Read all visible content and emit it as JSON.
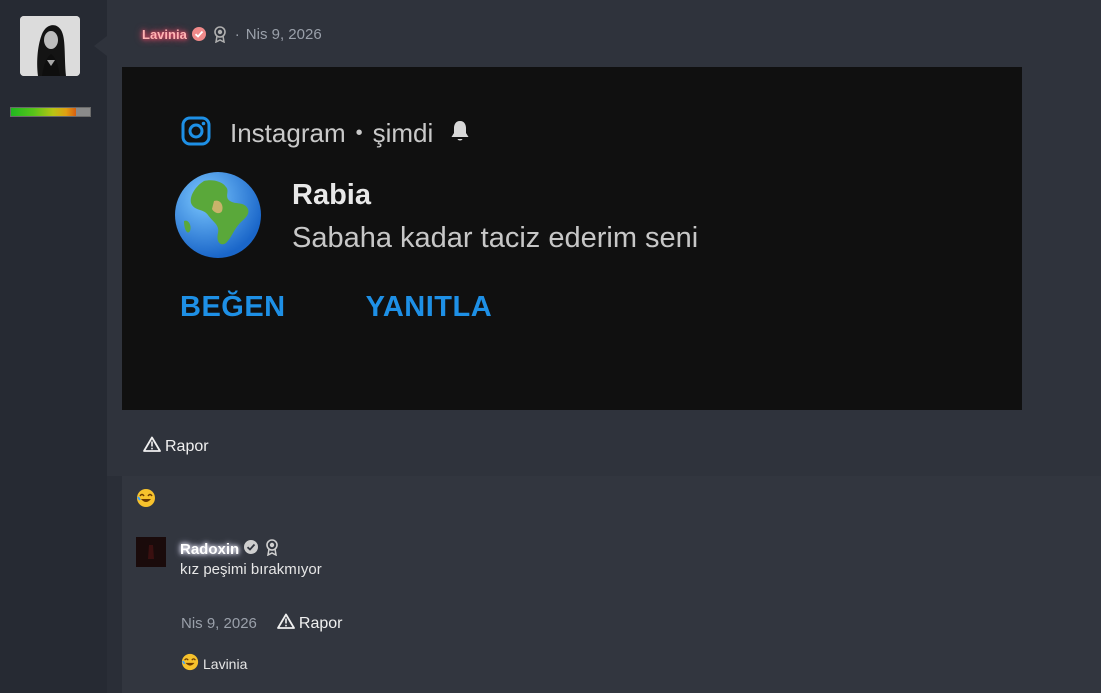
{
  "post": {
    "author": "Lavinia",
    "date_sep": "·",
    "date": "Nis 9, 2026",
    "report_label": "Rapor",
    "reputation_level": 0.82
  },
  "notification": {
    "app_name": "Instagram",
    "bullet": "•",
    "time": "şimdi",
    "sender": "Rabia",
    "message": "Sabaha kadar taciz ederim seni",
    "like_label": "BEĞEN",
    "reply_label": "YANITLA"
  },
  "reply": {
    "author": "Radoxin",
    "text": "kız peşimi bırakmıyor",
    "date": "Nis 9, 2026",
    "report_label": "Rapor",
    "reaction_user": "Lavinia"
  },
  "icons": {
    "verified": "verified-icon",
    "award": "award-icon",
    "warning": "warning-icon",
    "laugh": "laughing-emoji-icon",
    "instagram": "instagram-icon",
    "bell": "bell-icon",
    "globe": "globe-icon"
  },
  "colors": {
    "accent_blue": "#1e90e6",
    "author_glow": "#ff4d6d"
  }
}
